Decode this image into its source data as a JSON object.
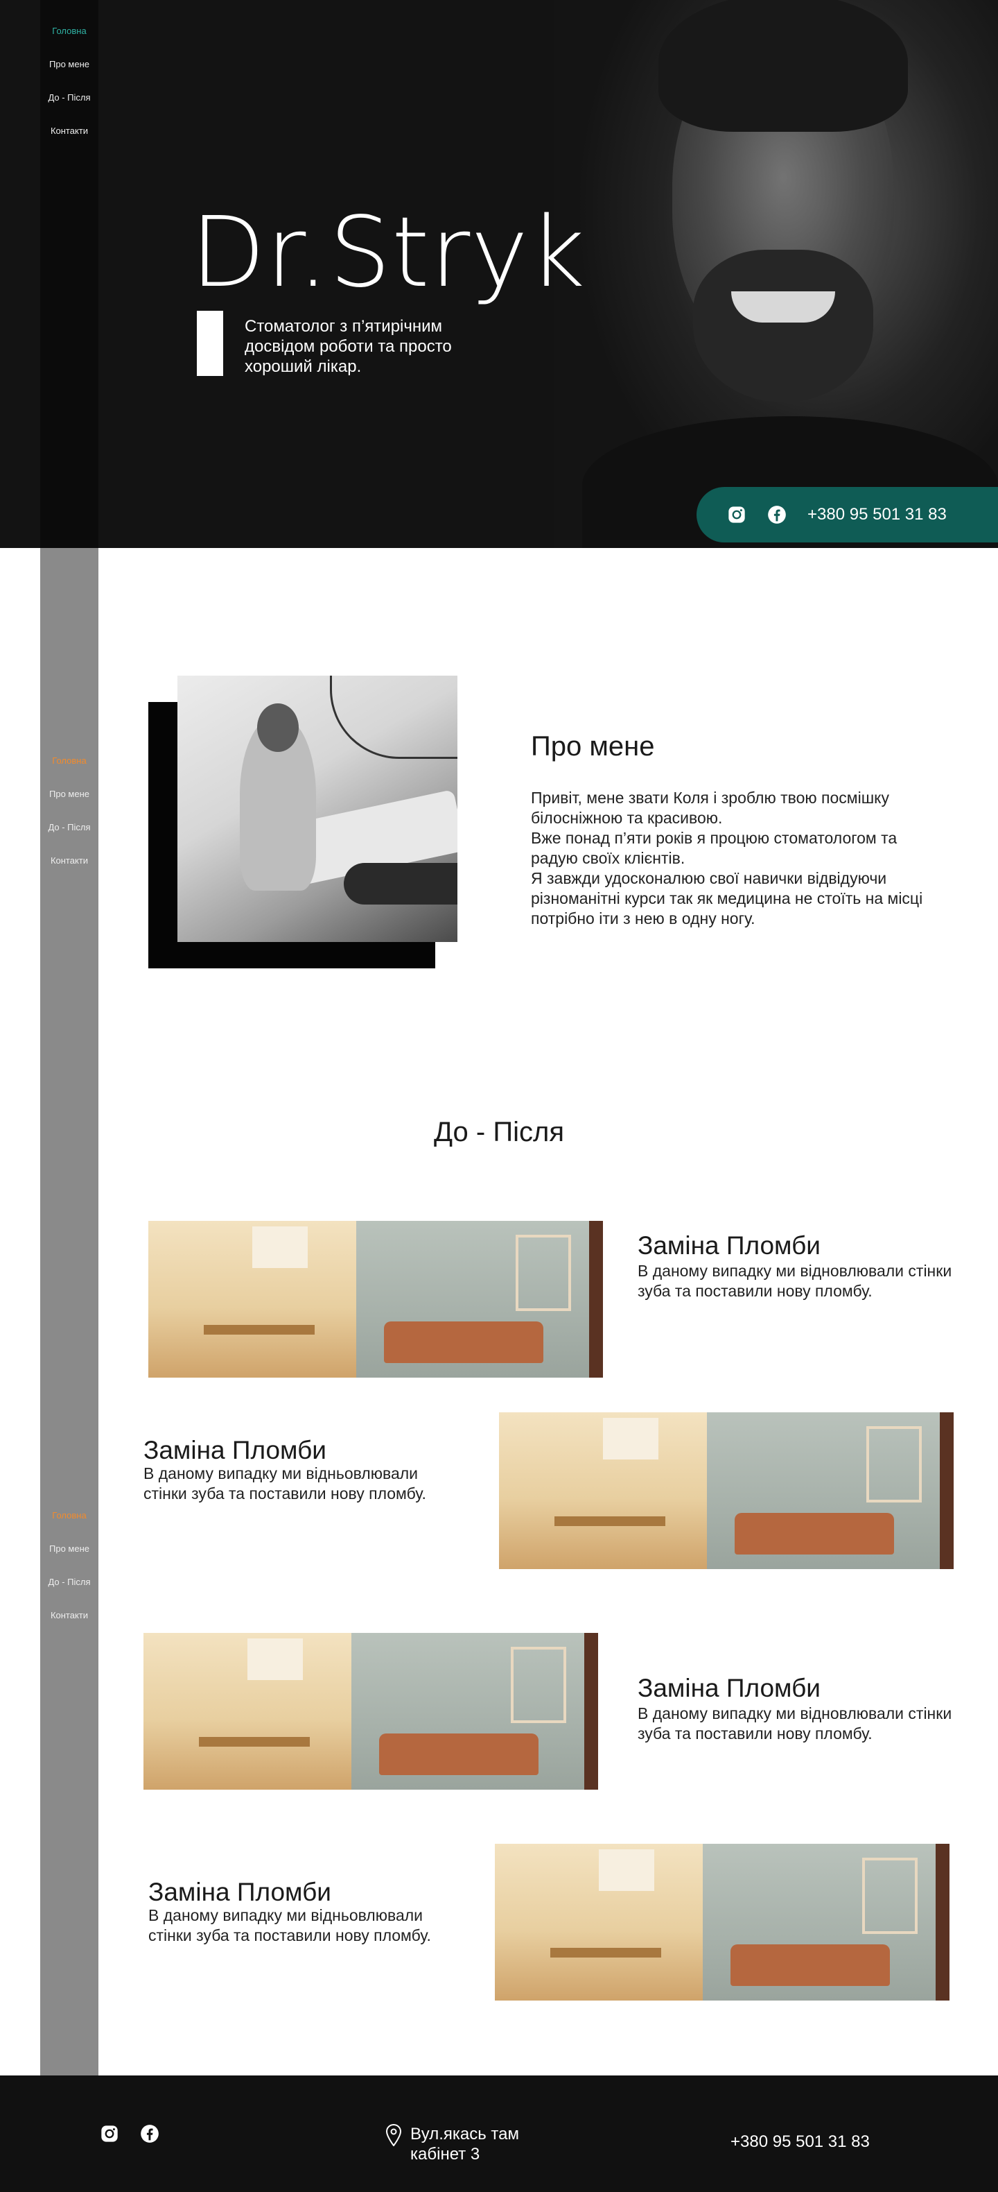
{
  "nav": {
    "items": [
      "Головна",
      "Про мене",
      "До - Після",
      "Контакти"
    ]
  },
  "hero": {
    "brand": "Dr.Stryk",
    "subtitle": "Стоматолог з п’ятирічним досвідом роботи та просто хороший лікар.",
    "phone": "+380 95 501 31 83"
  },
  "about": {
    "title": "Про мене",
    "lines": [
      "Привіт, мене звати Коля і зроблю твою посмішку білосніжною та красивою.",
      "Вже понад п’яти років я процюю стоматологом та радую своїх клієнтів.",
      "Я завжди удосконалюю свої навички відвідуючи різноманітні курси так як медицина не стоїть на місці потрібно іти з нею в одну ногу."
    ]
  },
  "before_after": {
    "title": "До - Після",
    "cases": [
      {
        "title": "Заміна Пломби",
        "text": "В даному випадку ми відновлювали стінки зуба та поставили нову пломбу."
      },
      {
        "title": "Заміна Пломби",
        "text": "В даному випадку ми відньовлювали стінки зуба та поставили нову пломбу."
      },
      {
        "title": "Заміна Пломби",
        "text": "В даному випадку ми відновлювали стінки зуба та поставили нову пломбу."
      },
      {
        "title": "Заміна Пломби",
        "text": "В даному випадку ми відньовлювали стінки зуба та поставили нову пломбу."
      }
    ]
  },
  "footer": {
    "address": "Вул.якась там кабінет 3",
    "phone": "+380 95 501 31 83"
  },
  "colors": {
    "accent_teal": "#2fb2a4",
    "accent_orange": "#f28b2c",
    "pill": "#0f5c55",
    "sidebar": "#8a8a8a"
  }
}
